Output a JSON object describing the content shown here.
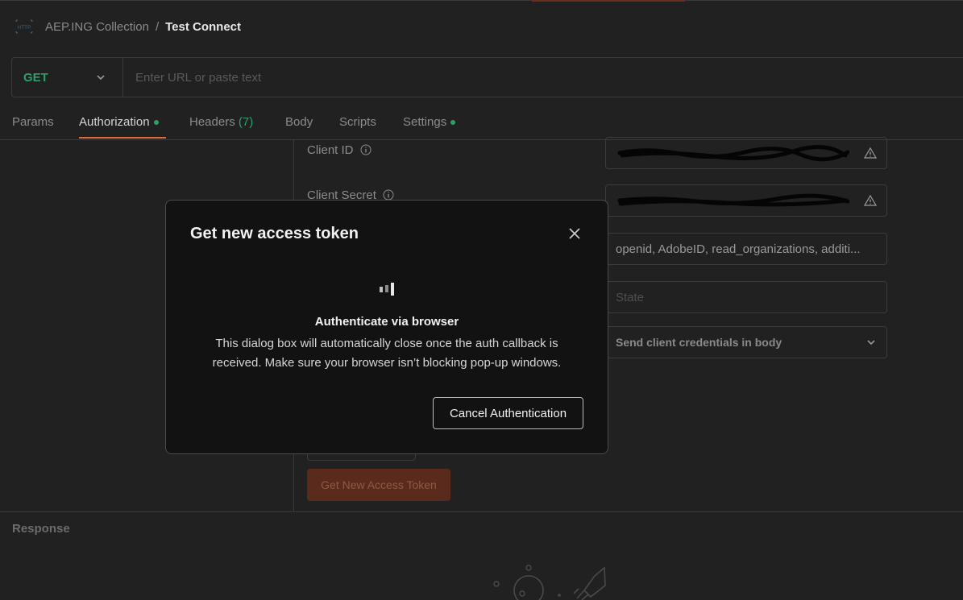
{
  "breadcrumb": {
    "collection": "AEP.ING Collection",
    "separator": "/",
    "request": "Test Connect"
  },
  "request": {
    "method": "GET",
    "url_placeholder": "Enter URL or paste text"
  },
  "tabs": [
    {
      "label": "Params"
    },
    {
      "label": "Authorization",
      "dot": true,
      "active": true
    },
    {
      "label": "Headers",
      "count": "(7)"
    },
    {
      "label": "Body"
    },
    {
      "label": "Scripts"
    },
    {
      "label": "Settings",
      "dot": true
    }
  ],
  "auth": {
    "client_id_label": "Client ID",
    "client_secret_label": "Client Secret",
    "scope_value": "openid, AdobeID, read_organizations, additi...",
    "state_placeholder": "State",
    "client_auth_value": "Send client credentials in body",
    "get_token_button": "Get New Access Token"
  },
  "response": {
    "label": "Response"
  },
  "modal": {
    "title": "Get new access token",
    "heading": "Authenticate via browser",
    "description": "This dialog box will automatically close once the auth callback is received. Make sure your browser isn’t blocking pop-up windows.",
    "cancel_button": "Cancel Authentication"
  },
  "colors": {
    "background": "#212121",
    "modal_background": "#121212",
    "method_get": "#2e9f6a",
    "accent": "#e0683d"
  }
}
